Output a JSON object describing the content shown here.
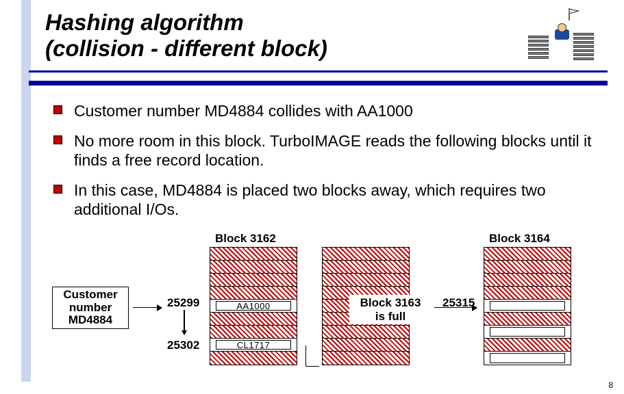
{
  "title_line1": "Hashing algorithm",
  "title_line2": "(collision - different block)",
  "bullets": [
    "Customer number MD4884 collides with AA1000",
    "No more room in this block. TurboIMAGE reads the following blocks until it finds a free record location.",
    "In this case, MD4884 is placed two blocks away, which requires two additional I/Os."
  ],
  "diagram": {
    "customer_label_1": "Customer",
    "customer_label_2": "number",
    "customer_label_3": "MD4884",
    "block1_label": "Block 3162",
    "block3_label": "Block 3164",
    "mid_label_1": "Block 3163",
    "mid_label_2": "is full",
    "rec1": "25299",
    "rec2": "25302",
    "rec3": "25315",
    "cell_aa": "AA1000",
    "cell_cl": "CL1717"
  },
  "pagenum": "8"
}
